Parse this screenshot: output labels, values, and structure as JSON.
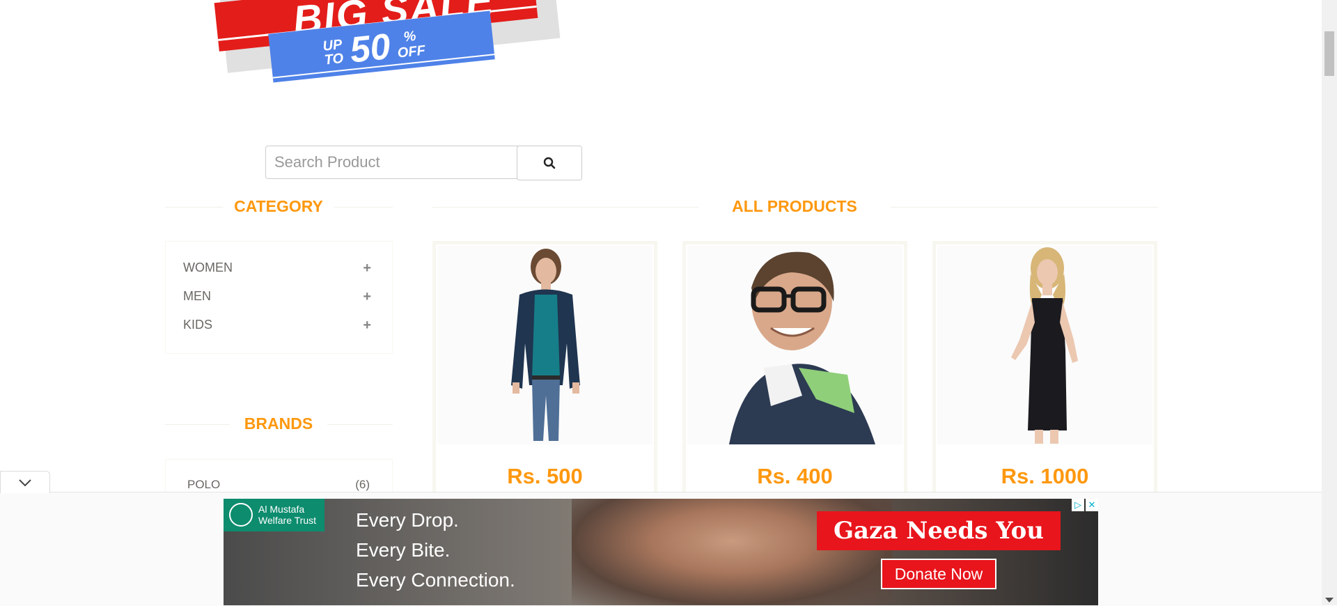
{
  "banner": {
    "title": "BIG SALE",
    "up": "UP",
    "to": "TO",
    "percent": "50",
    "pct_sign": "%",
    "off": "OFF"
  },
  "search": {
    "placeholder": "Search Product",
    "button_icon": "search-icon"
  },
  "sidebar": {
    "category_title": "CATEGORY",
    "categories": [
      {
        "label": "WOMEN",
        "icon": "plus-icon"
      },
      {
        "label": "MEN",
        "icon": "plus-icon"
      },
      {
        "label": "KIDS",
        "icon": "plus-icon"
      }
    ],
    "brands_title": "BRANDS",
    "brands": [
      {
        "label": "POLO",
        "count": "(6)"
      }
    ]
  },
  "main": {
    "title": "ALL PRODUCTS",
    "products": [
      {
        "price": "Rs. 500",
        "image": "woman-casual-outfit"
      },
      {
        "price": "Rs. 400",
        "image": "man-with-glasses"
      },
      {
        "price": "Rs. 1000",
        "image": "woman-black-dress"
      }
    ]
  },
  "ad": {
    "org_line1": "Al Mustafa",
    "org_line2": "Welfare Trust",
    "lines": [
      "Every Drop.",
      "Every Bite.",
      "Every Connection."
    ],
    "headline": "Gaza Needs You",
    "cta": "Donate Now",
    "controls": [
      "ad-choices-icon",
      "close-icon"
    ]
  },
  "colors": {
    "accent": "#fe980f",
    "text": "#696763",
    "sale_red": "#e31d1a",
    "sale_blue": "#4f82e8",
    "ad_red": "#e8151c",
    "ad_green": "#0d8c6e"
  }
}
